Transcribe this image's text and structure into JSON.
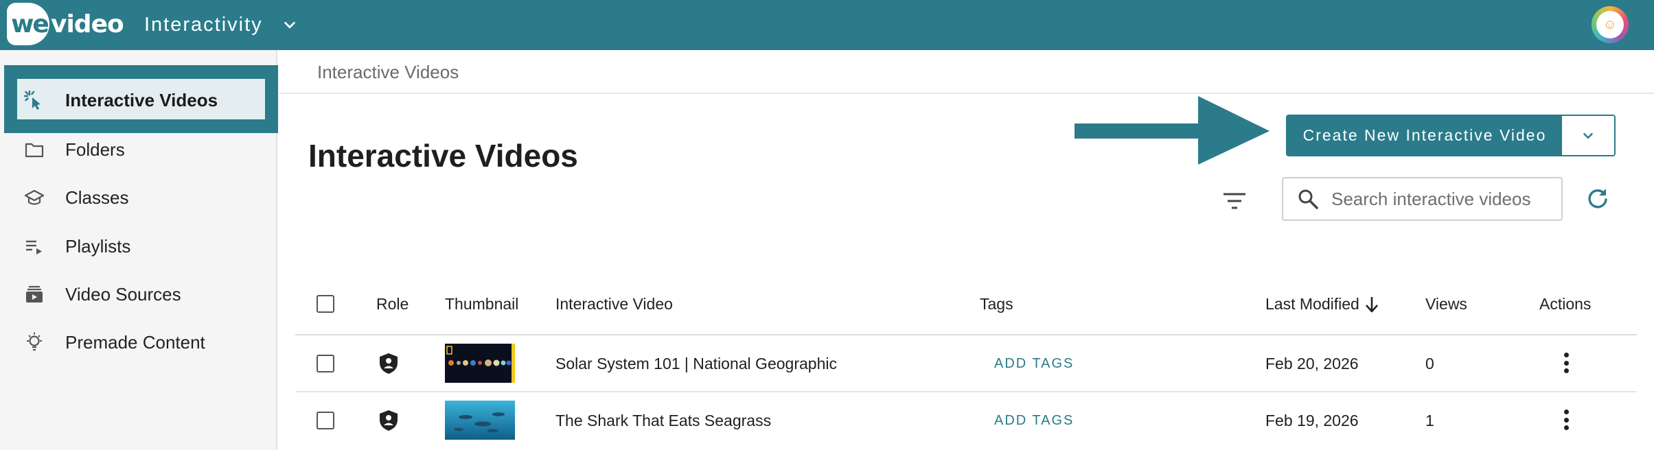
{
  "header": {
    "logo_prefix": "we",
    "logo_suffix": "video",
    "app_name": "Interactivity",
    "colors": {
      "brand": "#2b7b8a"
    }
  },
  "sidebar": {
    "items": [
      {
        "label": "Interactive Videos",
        "icon": "click-cursor-icon",
        "active": true
      },
      {
        "label": "Folders",
        "icon": "folder-icon"
      },
      {
        "label": "Classes",
        "icon": "graduation-cap-icon"
      },
      {
        "label": "Playlists",
        "icon": "playlist-icon"
      },
      {
        "label": "Video Sources",
        "icon": "video-sources-icon"
      },
      {
        "label": "Premade Content",
        "icon": "lightbulb-icon"
      }
    ]
  },
  "main": {
    "breadcrumb": "Interactive Videos",
    "title": "Interactive Videos",
    "create_button_label": "Create New Interactive Video",
    "search_placeholder": "Search interactive videos"
  },
  "table": {
    "headers": {
      "role": "Role",
      "thumbnail": "Thumbnail",
      "video": "Interactive Video",
      "tags": "Tags",
      "modified": "Last Modified",
      "views": "Views",
      "actions": "Actions"
    },
    "rows": [
      {
        "title": "Solar System 101 | National Geographic",
        "tags": "ADD TAGS",
        "modified": "Feb 20, 2026",
        "views": "0"
      },
      {
        "title": "The Shark That Eats Seagrass",
        "tags": "ADD TAGS",
        "modified": "Feb 19, 2026",
        "views": "1"
      }
    ]
  }
}
